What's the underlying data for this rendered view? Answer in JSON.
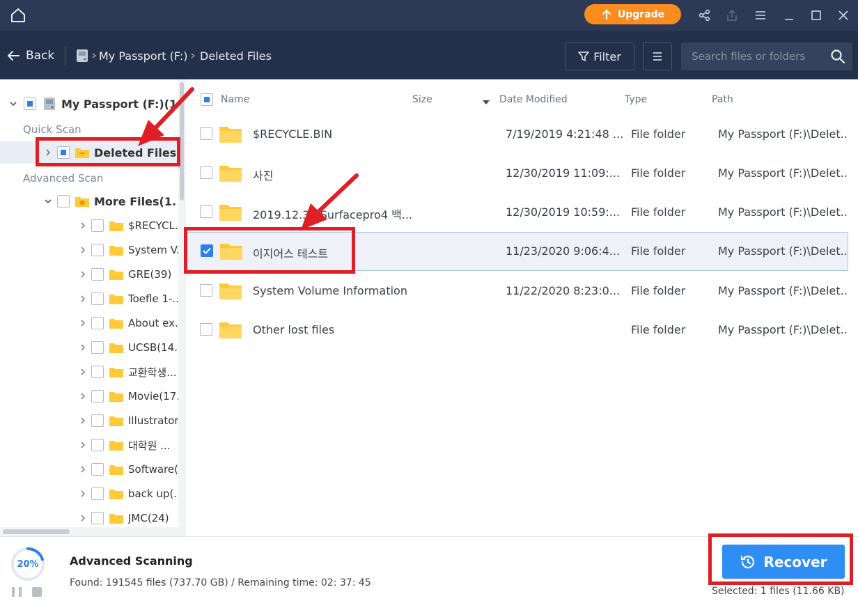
{
  "titlebar": {
    "upgrade_label": "Upgrade",
    "accent": "#fb8c1e"
  },
  "toolbar": {
    "back_label": "Back",
    "breadcrumb": [
      "My Passport (F:)",
      "Deleted Files"
    ],
    "filter_label": "Filter",
    "search_placeholder": "Search files or folders"
  },
  "sidebar": {
    "root_label": "My Passport (F:)(1...",
    "quick_scan_label": "Quick Scan",
    "deleted_files_label": "Deleted Files...",
    "advanced_scan_label": "Advanced Scan",
    "more_files_label": "More Files(1...",
    "folders": [
      "$RECYCL...",
      "System V...",
      "GRE(39)",
      "Toefle 1-...",
      "About ex...",
      "UCSB(14...",
      "교환학생...",
      "Movie(17...",
      "Illustrator",
      "대학원 ...",
      "Software(...",
      "back up(...",
      "JMC(24)"
    ]
  },
  "list": {
    "columns": {
      "name": "Name",
      "size": "Size",
      "date": "Date Modified",
      "type": "Type",
      "path": "Path"
    },
    "rows": [
      {
        "name": "$RECYCLE.BIN",
        "date": "7/19/2019 4:21:48 ...",
        "type": "File folder",
        "path": "My Passport (F:)\\Delet...",
        "checked": false
      },
      {
        "name": "사진",
        "date": "12/30/2019 11:09:...",
        "type": "File folder",
        "path": "My Passport (F:)\\Delet...",
        "checked": false
      },
      {
        "name": "2019.12.30 Surfacepro4 백...",
        "date": "12/30/2019 10:59:...",
        "type": "File folder",
        "path": "My Passport (F:)\\Delet...",
        "checked": false
      },
      {
        "name": "이지어스 테스트",
        "date": "11/23/2020 9:06:4...",
        "type": "File folder",
        "path": "My Passport (F:)\\Delet...",
        "checked": true
      },
      {
        "name": "System Volume Information",
        "date": "11/22/2020 8:23:0...",
        "type": "File folder",
        "path": "My Passport (F:)\\Delet...",
        "checked": false
      },
      {
        "name": "Other lost files",
        "date": "",
        "type": "File folder",
        "path": "My Passport (F:)\\Delet...",
        "checked": false
      }
    ]
  },
  "status": {
    "progress_pct": "20%",
    "progress_value": 0.2,
    "title": "Advanced Scanning",
    "found_info": "Found: 191545 files (737.70 GB) / Remaining time: 02: 37: 45",
    "recover_label": "Recover",
    "selected_info": "Selected: 1 files (11.66 KB)",
    "accent": "#2f8ef4"
  }
}
